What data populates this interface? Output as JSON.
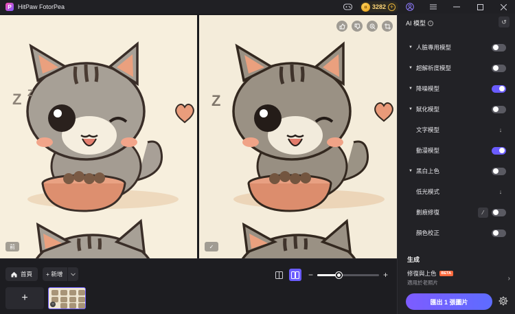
{
  "app": {
    "title": "HitPaw FotorPea"
  },
  "titlebar": {
    "coins": "3282",
    "window_controls": [
      "menu",
      "minimize",
      "maximize",
      "close"
    ]
  },
  "canvas": {
    "left_tag": "前",
    "right_tag": "✓",
    "float_tools": [
      "thumbs-up-icon",
      "thumbs-down-icon",
      "zoom-icon",
      "crop-icon"
    ]
  },
  "bottom": {
    "home_label": "首頁",
    "add_label": "+ 新增",
    "zoom_level_fraction": 0.35
  },
  "panel": {
    "header": "AI 模型",
    "models": [
      {
        "label": "人臉專用模型",
        "kind": "toggle",
        "on": false,
        "caret": true
      },
      {
        "label": "超解析度模型",
        "kind": "toggle",
        "on": false,
        "caret": true
      },
      {
        "label": "降噪模型",
        "kind": "toggle",
        "on": true,
        "caret": true
      },
      {
        "label": "賦化模型",
        "kind": "toggle",
        "on": false,
        "caret": true
      },
      {
        "label": "文字模型",
        "kind": "arrow",
        "on": false,
        "caret": false
      },
      {
        "label": "動漫模型",
        "kind": "toggle",
        "on": true,
        "caret": false
      },
      {
        "label": "黑白上色",
        "kind": "toggle",
        "on": false,
        "caret": true
      },
      {
        "label": "低光模式",
        "kind": "arrow",
        "on": false,
        "caret": false
      },
      {
        "label": "劃痕修復",
        "kind": "toggle-fix",
        "on": false,
        "caret": false
      },
      {
        "label": "顏色校正",
        "kind": "toggle",
        "on": false,
        "caret": false
      }
    ],
    "generate": {
      "heading": "生成",
      "card_title": "修復與上色",
      "card_badge": "BETA",
      "card_sub": "適用於老照片"
    },
    "export_label": "匯出 1 張圖片"
  },
  "colors": {
    "accent": "#6a5cff",
    "coin": "#f2b534",
    "beta": "#ff6a3d"
  }
}
